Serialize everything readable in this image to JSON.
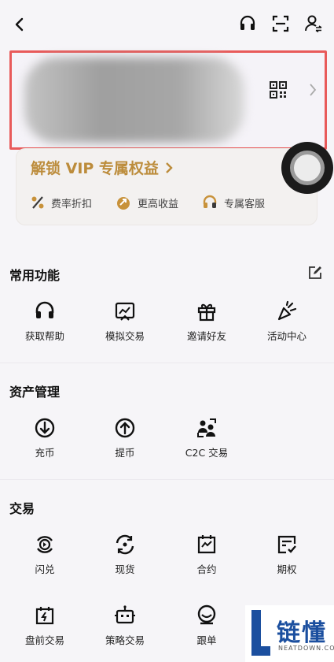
{
  "header": {
    "back_icon": "chevron-left-icon",
    "icons": [
      "headset-icon",
      "scan-icon",
      "user-switch-icon"
    ]
  },
  "profile": {
    "qr_icon": "qr-code-icon",
    "chevron_icon": "chevron-right-icon"
  },
  "vip": {
    "title": "解锁 VIP 专属权益",
    "benefits": [
      {
        "label": "费率折扣",
        "icon": "percent-icon"
      },
      {
        "label": "更高收益",
        "icon": "yield-icon"
      },
      {
        "label": "专属客服",
        "icon": "headset-icon"
      }
    ]
  },
  "common": {
    "title": "常用功能",
    "items": [
      {
        "label": "获取帮助",
        "icon": "headset-icon"
      },
      {
        "label": "模拟交易",
        "icon": "simulated-trade-icon"
      },
      {
        "label": "邀请好友",
        "icon": "gift-icon"
      },
      {
        "label": "活动中心",
        "icon": "party-popper-icon"
      }
    ]
  },
  "assets": {
    "title": "资产管理",
    "items": [
      {
        "label": "充币",
        "icon": "deposit-icon"
      },
      {
        "label": "提币",
        "icon": "withdraw-icon"
      },
      {
        "label": "C2C 交易",
        "icon": "c2c-icon"
      }
    ]
  },
  "trade": {
    "title": "交易",
    "items": [
      {
        "label": "闪兑",
        "icon": "flash-swap-icon"
      },
      {
        "label": "现货",
        "icon": "spot-icon"
      },
      {
        "label": "合约",
        "icon": "futures-icon"
      },
      {
        "label": "期权",
        "icon": "options-icon"
      },
      {
        "label": "盘前交易",
        "icon": "pre-market-icon"
      },
      {
        "label": "策略交易",
        "icon": "bot-icon"
      },
      {
        "label": "跟单",
        "icon": "copy-trade-icon"
      }
    ]
  },
  "watermark": {
    "text": "链懂",
    "sub": "NEATDOWN.COM"
  },
  "colors": {
    "vip_gold": "#bc8c3b",
    "highlight_border": "#e85a5a",
    "watermark_blue": "#1b4f9f"
  }
}
